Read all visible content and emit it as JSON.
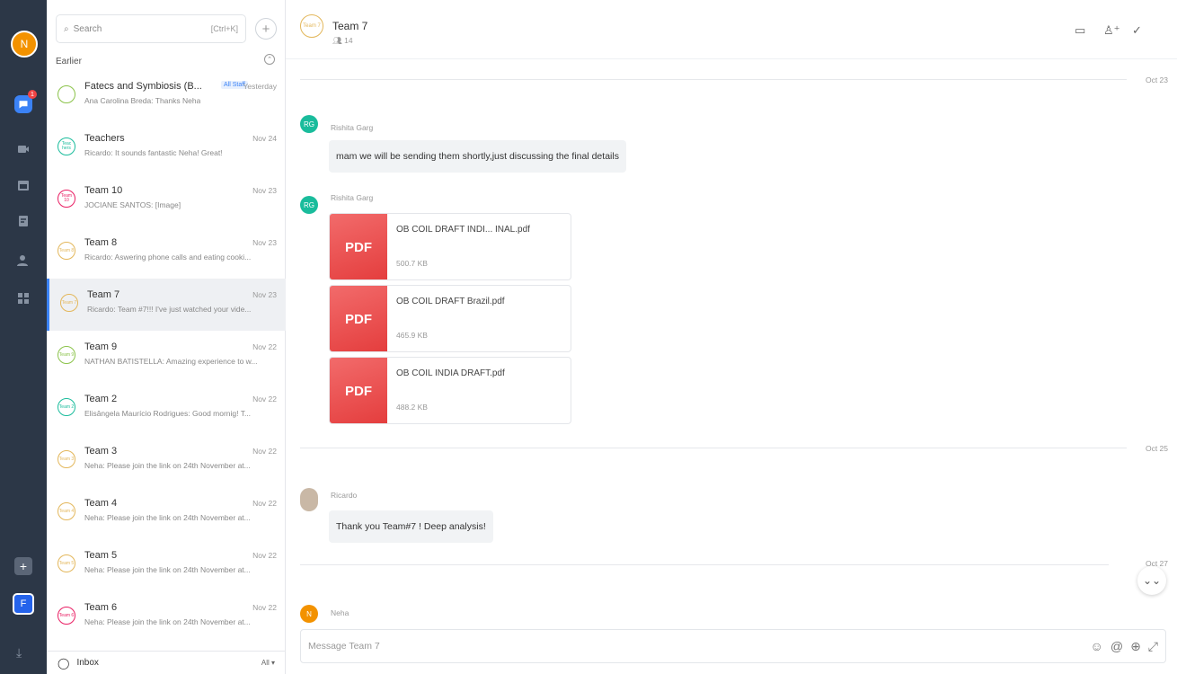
{
  "user": {
    "initial": "N"
  },
  "rail": {
    "chat_badge": "1",
    "org_initial": "F",
    "add_label": "+"
  },
  "search": {
    "placeholder": "Search",
    "shortcut": "[Ctrl+K]"
  },
  "list": {
    "section_label": "Earlier",
    "conversations": [
      {
        "name": "Fatecs and Symbiosis (B...",
        "tag": "All Staff",
        "date": "Yesterday",
        "preview": "Ana Carolina Breda: Thanks Neha",
        "icon_text": ""
      },
      {
        "name": "Teachers",
        "date": "Nov 24",
        "preview": "Ricardo: It sounds fantastic Neha! Great!",
        "icon_text": "Teac hers"
      },
      {
        "name": "Team 10",
        "date": "Nov 23",
        "preview": "JOCIANE SANTOS: [Image]",
        "icon_text": "Team 10"
      },
      {
        "name": "Team 8",
        "date": "Nov 23",
        "preview": "Ricardo: Aswering phone calls and eating cooki...",
        "icon_text": "Team 8"
      },
      {
        "name": "Team 7",
        "date": "Nov 23",
        "preview": "Ricardo: Team #7!!! I've just watched your vide...",
        "icon_text": "Team 7"
      },
      {
        "name": "Team 9",
        "date": "Nov 22",
        "preview": "NATHAN BATISTELLA: Amazing experience to w...",
        "icon_text": "Team 9"
      },
      {
        "name": "Team 2",
        "date": "Nov 22",
        "preview": "Elisângela Maurício Rodrigues: Good mornig! T...",
        "icon_text": "Team 2"
      },
      {
        "name": "Team 3",
        "date": "Nov 22",
        "preview": "Neha: Please join the link on 24th November at...",
        "icon_text": "Team 3"
      },
      {
        "name": "Team 4",
        "date": "Nov 22",
        "preview": "Neha: Please join the link on 24th November at...",
        "icon_text": "Team 4"
      },
      {
        "name": "Team 5",
        "date": "Nov 22",
        "preview": "Neha: Please join the link on 24th November at...",
        "icon_text": "Team 5"
      },
      {
        "name": "Team 6",
        "date": "Nov 22",
        "preview": "Neha: Please join the link on 24th November at...",
        "icon_text": "Team 6"
      }
    ],
    "inbox_label": "Inbox",
    "inbox_filter": "All"
  },
  "header": {
    "title": "Team 7",
    "members": "14",
    "icon_text": "Team 7"
  },
  "chat": {
    "date_1": "Oct 23",
    "date_2": "Oct 25",
    "date_3": "Oct 27",
    "msg1_sender": "Rishita Garg",
    "msg1_initials": "RG",
    "msg1_text": "mam we will be sending them shortly,just discussing the final details",
    "msg2_sender": "Rishita Garg",
    "msg2_initials": "RG",
    "files": [
      {
        "label": "PDF",
        "name": "OB COIL DRAFT INDI... INAL.pdf",
        "size": "500.7 KB"
      },
      {
        "label": "PDF",
        "name": "OB COIL DRAFT Brazil.pdf",
        "size": "465.9 KB"
      },
      {
        "label": "PDF",
        "name": "OB COIL INDIA DRAFT.pdf",
        "size": "488.2 KB"
      }
    ],
    "msg3_sender": "Ricardo",
    "msg3_text": "Thank you Team#7 ! Deep analysis!",
    "msg4_sender": "Neha",
    "msg4_initials": "N"
  },
  "composer": {
    "placeholder": "Message Team 7"
  },
  "colors": {
    "rail_bg": "#2c3747",
    "accent": "#3b82f6",
    "rg_avatar": "#1abc9c",
    "neha_avatar": "#f39200",
    "pdf_red": "#e84545"
  }
}
